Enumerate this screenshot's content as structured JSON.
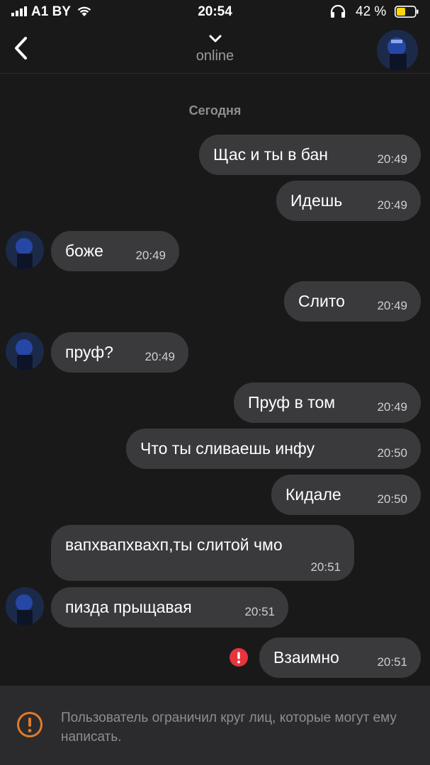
{
  "status_bar": {
    "carrier": "A1 BY",
    "time": "20:54",
    "battery": "42 %"
  },
  "nav": {
    "status": "online"
  },
  "date_separator": "Сегодня",
  "messages": [
    {
      "side": "out",
      "text": "Щас и ты в бан",
      "time": "20:49"
    },
    {
      "side": "out",
      "text": "Идешь",
      "time": "20:49"
    },
    {
      "side": "in",
      "text": "боже",
      "time": "20:49"
    },
    {
      "side": "out",
      "text": "Слито",
      "time": "20:49"
    },
    {
      "side": "in",
      "text": "пруф?",
      "time": "20:49"
    },
    {
      "side": "out",
      "text": "Пруф в том",
      "time": "20:49"
    },
    {
      "side": "out",
      "text": "Что ты сливаешь инфу",
      "time": "20:50"
    },
    {
      "side": "out",
      "text": "Кидале",
      "time": "20:50"
    },
    {
      "side": "in",
      "text": "вапхвапхвахп,ты слитой чмо",
      "time": "20:51"
    },
    {
      "side": "in",
      "text": "пизда прыщавая",
      "time": "20:51"
    },
    {
      "side": "out",
      "text": "Взаимно",
      "time": "20:51",
      "error": true
    }
  ],
  "footer": {
    "notice": "Пользователь ограничил круг лиц, которые могут ему написать."
  },
  "colors": {
    "background": "#19191a",
    "bubble": "#3a3a3c",
    "footer": "#2b2b2d",
    "warning": "#e07b2a",
    "error": "#e8343c",
    "battery": "#ffd60a"
  },
  "icons": [
    "signal-icon",
    "wifi-icon",
    "headphones-icon",
    "battery-icon",
    "back-icon",
    "chevron-down-icon",
    "error-icon",
    "warning-icon"
  ]
}
